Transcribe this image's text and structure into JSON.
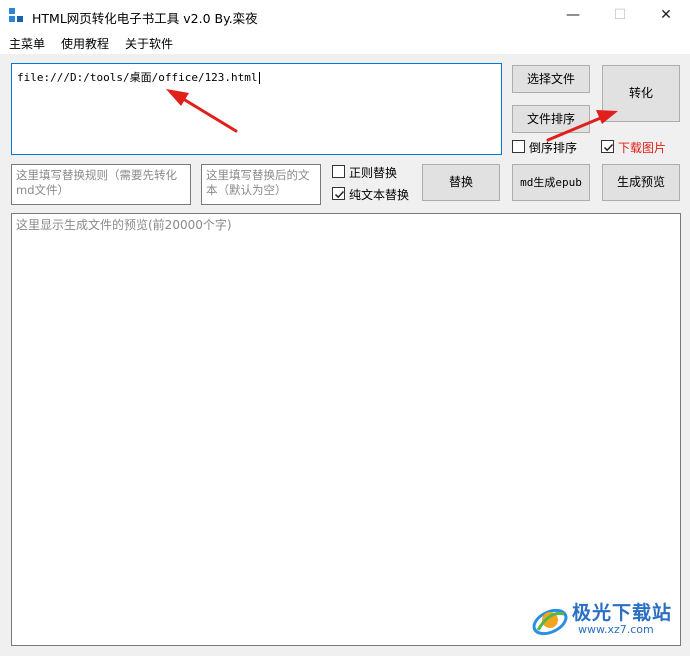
{
  "window": {
    "title": "HTML网页转化电子书工具 v2.0 By.栾夜",
    "minimize_glyph": "—",
    "maximize_glyph": "☐",
    "close_glyph": "✕"
  },
  "menu": {
    "items": [
      "主菜单",
      "使用教程",
      "关于软件"
    ]
  },
  "url_input": {
    "value": "file:///D:/tools/桌面/office/123.html"
  },
  "buttons": {
    "select_file": "选择文件",
    "convert": "转化",
    "sort_files": "文件排序",
    "replace": "替换",
    "md_to_epub": "md生成epub",
    "generate_preview": "生成预览"
  },
  "checkboxes": {
    "reverse_sort": {
      "label": "倒序排序",
      "checked": false
    },
    "download_images": {
      "label": "下载图片",
      "checked": true
    },
    "regex_replace": {
      "label": "正则替换",
      "checked": false
    },
    "plain_text_replace": {
      "label": "纯文本替换",
      "checked": true
    }
  },
  "replace_rule_input": {
    "placeholder": "这里填写替换规则（需要先转化md文件）"
  },
  "replace_with_input": {
    "placeholder": "这里填写替换后的文本（默认为空）"
  },
  "preview": {
    "placeholder": "这里显示生成文件的预览(前20000个字)"
  },
  "watermark": {
    "title": "极光下载站",
    "url": "www.xz7.com"
  },
  "colors": {
    "accent": "#0078d7",
    "arrow": "#e0201b",
    "download_label": "#e0201b",
    "watermark": "#2b6fc4"
  }
}
